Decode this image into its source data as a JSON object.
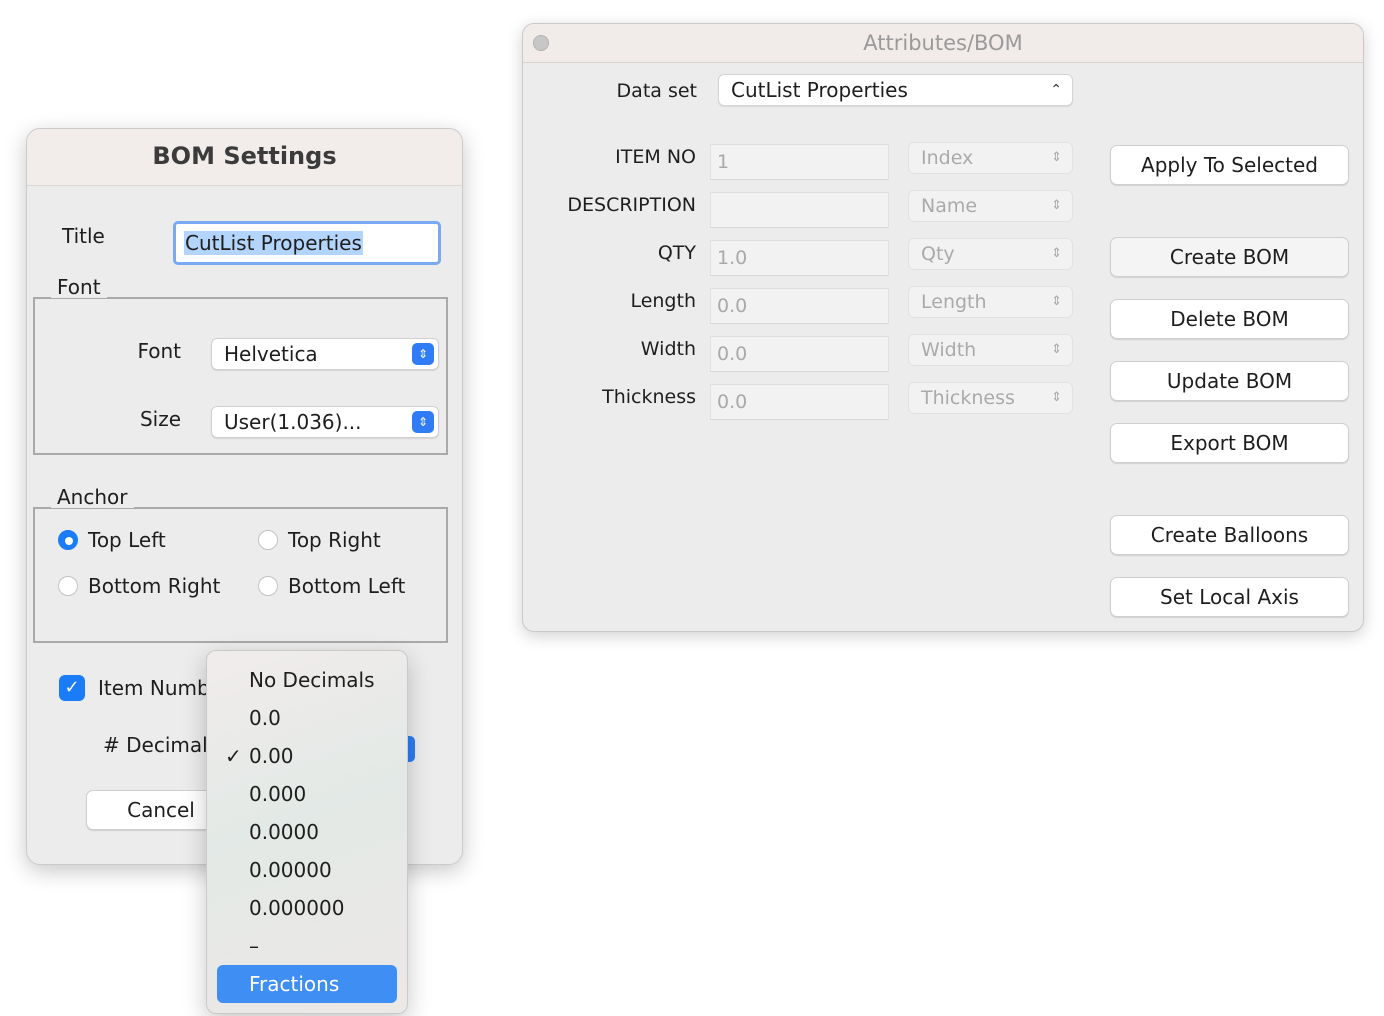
{
  "attributes_window": {
    "title": "Attributes/BOM",
    "data_set_label": "Data set",
    "data_set_value": "CutList Properties",
    "fields": [
      {
        "label": "ITEM NO",
        "value": "1",
        "source": "Index"
      },
      {
        "label": "DESCRIPTION",
        "value": "",
        "source": "Name"
      },
      {
        "label": "QTY",
        "value": "1.0",
        "source": "Qty"
      },
      {
        "label": "Length",
        "value": "0.0",
        "source": "Length"
      },
      {
        "label": "Width",
        "value": "0.0",
        "source": "Width"
      },
      {
        "label": "Thickness",
        "value": "0.0",
        "source": "Thickness"
      }
    ],
    "buttons": {
      "apply_to_selected": "Apply To Selected",
      "create_bom": "Create BOM",
      "delete_bom": "Delete BOM",
      "update_bom": "Update BOM",
      "export_bom": "Export BOM",
      "create_balloons": "Create Balloons",
      "set_local_axis": "Set Local Axis"
    }
  },
  "bom_settings": {
    "title": "BOM Settings",
    "title_label": "Title",
    "title_value": "CutList Properties",
    "font_group": "Font",
    "font_label": "Font",
    "font_value": "Helvetica",
    "size_label": "Size",
    "size_value": "User(1.036)...",
    "anchor_group": "Anchor",
    "anchor_options": {
      "top_left": "Top Left",
      "top_right": "Top Right",
      "bottom_right": "Bottom Right",
      "bottom_left": "Bottom Left"
    },
    "anchor_selected": "Top Left",
    "item_number_label": "Item Numb",
    "item_number_checked": true,
    "decimals_label": "# Decimals",
    "cancel_button": "Cancel"
  },
  "decimals_menu": {
    "items": [
      "No Decimals",
      "0.0",
      "0.00",
      "0.000",
      "0.0000",
      "0.00000",
      "0.000000",
      "–"
    ],
    "checked_item": "0.00",
    "highlighted_item": "Fractions"
  },
  "colors": {
    "accent_blue": "#1a7cf7",
    "menu_highlight": "#3f8ef4",
    "window_bg": "#ececec"
  }
}
